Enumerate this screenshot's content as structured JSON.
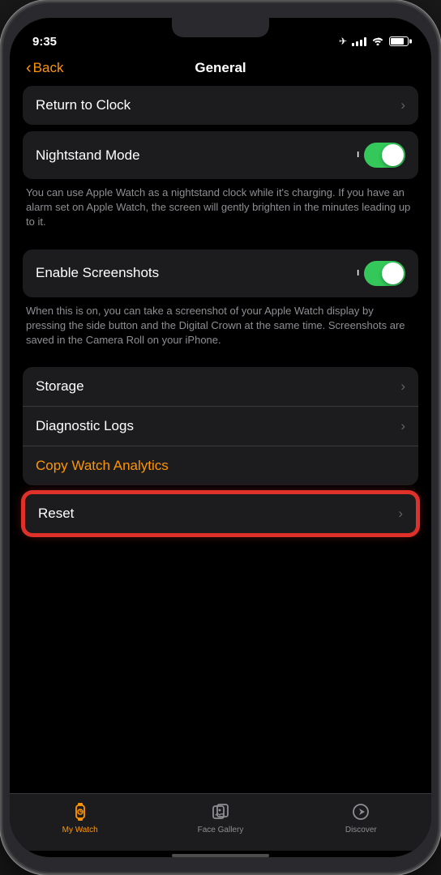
{
  "statusBar": {
    "time": "9:35",
    "locationIcon": "◁"
  },
  "header": {
    "backLabel": "Back",
    "title": "General"
  },
  "sections": {
    "returnToClock": {
      "label": "Return to Clock"
    },
    "nightstandMode": {
      "label": "Nightstand Mode",
      "toggleOn": true,
      "description": "You can use Apple Watch as a nightstand clock while it's charging. If you have an alarm set on Apple Watch, the screen will gently brighten in the minutes leading up to it."
    },
    "enableScreenshots": {
      "label": "Enable Screenshots",
      "toggleOn": true,
      "description": "When this is on, you can take a screenshot of your Apple Watch display by pressing the side button and the Digital Crown at the same time. Screenshots are saved in the Camera Roll on your iPhone."
    },
    "diagnostics": {
      "storageLabel": "Storage",
      "diagnosticLogsLabel": "Diagnostic Logs",
      "copyWatchAnalyticsLabel": "Copy Watch Analytics"
    },
    "reset": {
      "label": "Reset"
    }
  },
  "tabBar": {
    "tabs": [
      {
        "id": "my-watch",
        "label": "My Watch",
        "active": true
      },
      {
        "id": "face-gallery",
        "label": "Face Gallery",
        "active": false
      },
      {
        "id": "discover",
        "label": "Discover",
        "active": false
      }
    ]
  }
}
